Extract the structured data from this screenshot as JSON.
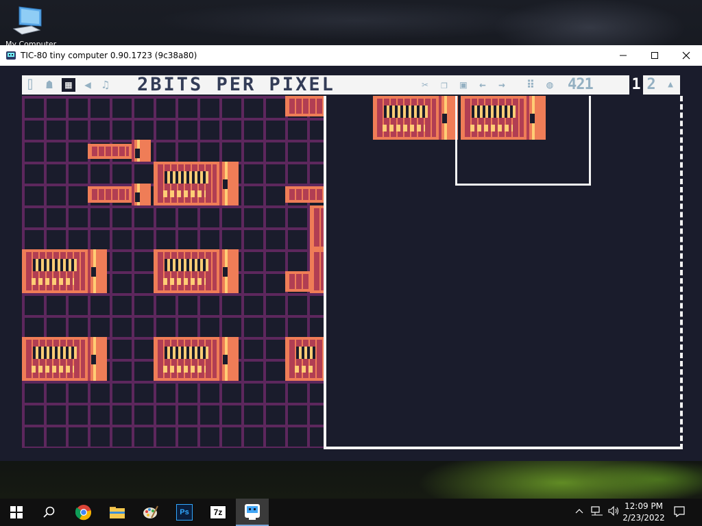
{
  "desktop": {
    "icon_label": "My Computer"
  },
  "window": {
    "title": "TIC-80 tiny computer 0.90.1723 (9c38a80)",
    "controls": {
      "minimize": "—",
      "maximize": "☐",
      "close": "✕"
    }
  },
  "editor": {
    "mode_title": "2BITS PER PIXEL",
    "bpp_options": "421",
    "pages": [
      "1",
      "2"
    ],
    "icons": [
      "code-editor-icon",
      "sprite-editor-icon",
      "map-editor-icon",
      "sfx-editor-icon",
      "music-editor-icon",
      "cut-icon",
      "copy-icon",
      "paste-icon",
      "undo-icon",
      "redo-icon",
      "grid-icon",
      "blend-icon",
      "page-up-icon"
    ],
    "colors": {
      "bg": "#1a1c2c",
      "grid": "#5d275d",
      "sprite_dark": "#b13e53",
      "sprite_mid": "#ef7d57",
      "sprite_light": "#ffcd75",
      "toolbar_bg": "#f4f4f4",
      "toolbar_text": "#333c57"
    }
  },
  "taskbar": {
    "apps": [
      "start-icon",
      "search-icon",
      "chrome-icon",
      "file-explorer-icon",
      "paint-icon",
      "photoshop-icon",
      "7zip-icon",
      "tic80-icon"
    ],
    "photoshop_label": "Ps",
    "sevenzip_label": "7z",
    "time": "12:09 PM",
    "date": "2/23/2022"
  }
}
